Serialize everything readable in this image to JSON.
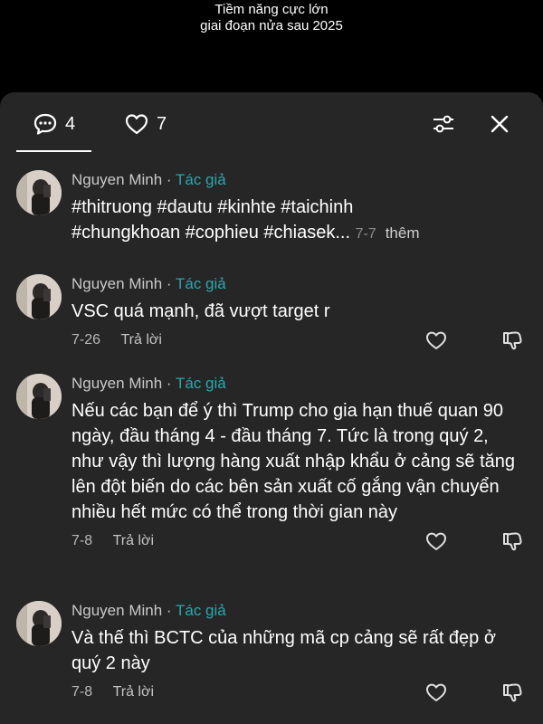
{
  "video": {
    "caption_line1": "Tiềm năng cực lớn",
    "caption_line2": "giai đoạn nửa sau 2025"
  },
  "header": {
    "comment_count": "4",
    "like_count": "7",
    "icons": [
      "comment-icon",
      "heart-icon",
      "filter-icon",
      "close-icon"
    ]
  },
  "comments": [
    {
      "author": "Nguyen Minh",
      "separator": "·",
      "badge": "Tác giả",
      "text_line1": "#thitruong #dautu #kinhte #taichinh",
      "text_line2": "#chungkhoan #cophieu #chiasek...",
      "date": "7-7",
      "more": "thêm"
    },
    {
      "author": "Nguyen Minh",
      "separator": "·",
      "badge": "Tác giả",
      "text": "VSC quá mạnh, đã vượt target r",
      "date": "7-26",
      "reply": "Trả lời"
    },
    {
      "author": "Nguyen Minh",
      "separator": "·",
      "badge": "Tác giả",
      "text": "Nếu các bạn để ý thì Trump cho gia hạn thuế quan 90 ngày, đầu tháng 4 - đầu tháng 7. Tức là trong quý 2, như vậy thì lượng hàng xuất nhập khẩu ở cảng sẽ tăng lên đột biến do các bên sản xuất cố gắng vận chuyển nhiều hết mức có thể trong thời gian này",
      "date": "7-8",
      "reply": "Trả lời"
    },
    {
      "author": "Nguyen Minh",
      "separator": "·",
      "badge": "Tác giả",
      "text": "Và thế thì BCTC của những mã cp cảng sẽ rất đẹp ở quý 2 này",
      "date": "7-8",
      "reply": "Trả lời"
    }
  ],
  "colors": {
    "sheet_bg": "#262626",
    "author_badge": "#2aa7ad",
    "meta_text": "#b8b8b8"
  }
}
